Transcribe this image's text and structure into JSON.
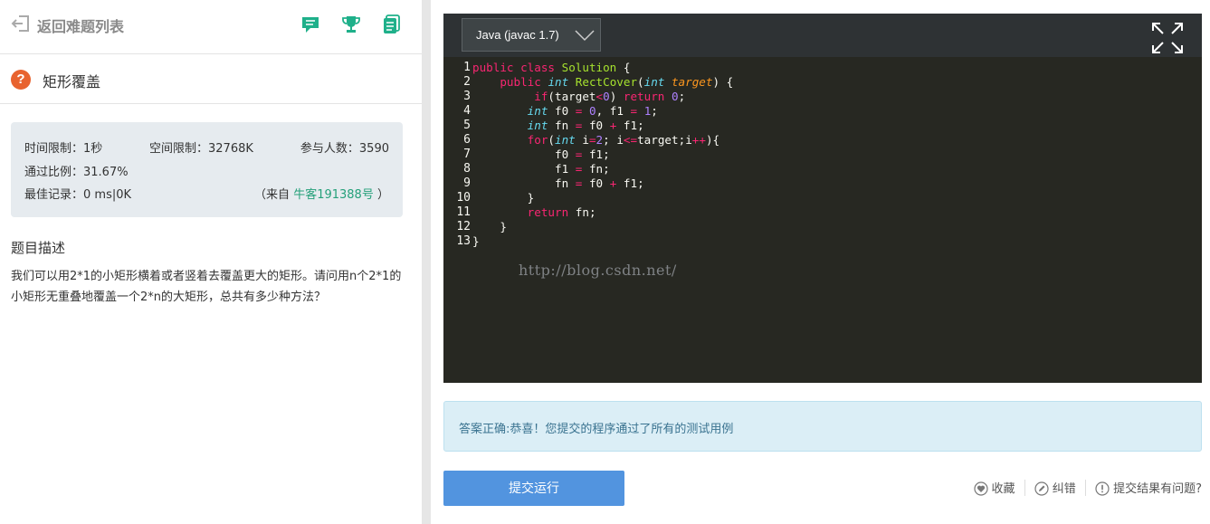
{
  "nav": {
    "back_label": "返回难题列表"
  },
  "problem": {
    "title": "矩形覆盖",
    "time_limit": "时间限制：1秒",
    "memory_limit": "空间限制：32768K",
    "participants": "参与人数：3590",
    "pass_rate": "通过比例：31.67%",
    "best_record": "最佳记录：0 ms|0K",
    "source_prefix": "（来自",
    "source_link": "牛客191388号",
    "source_suffix": "）",
    "desc_heading": "题目描述",
    "desc_text": "我们可以用2*1的小矩形横着或者竖着去覆盖更大的矩形。请问用n个2*1的小矩形无重叠地覆盖一个2*n的大矩形，总共有多少种方法？"
  },
  "editor": {
    "language": "Java (javac 1.7)",
    "line_numbers": [
      "1",
      "2",
      "3",
      "4",
      "5",
      "6",
      "7",
      "8",
      "9",
      "10",
      "11",
      "12",
      "13"
    ],
    "code_lines": [
      "public class Solution {",
      "    public int RectCover(int target) {",
      "         if(target<0) return 0;",
      "        int f0 = 0, f1 = 1;",
      "        int fn = f0 + f1;",
      "        for(int i=2; i<=target;i++){",
      "            f0 = f1;",
      "            f1 = fn;",
      "            fn = f0 + f1;",
      "        }",
      "        return fn;",
      "    }",
      "}"
    ],
    "watermark": "http://blog.csdn.net/"
  },
  "result": {
    "message": "答案正确:恭喜！您提交的程序通过了所有的测试用例"
  },
  "actions": {
    "submit_label": "提交运行",
    "favorite_label": "收藏",
    "report_label": "纠错",
    "feedback_label": "提交结果有问题?"
  },
  "colors": {
    "accent_teal": "#25a07a",
    "question_orange": "#e8632f",
    "submit_blue": "#5294df",
    "editor_bg": "#272822"
  }
}
